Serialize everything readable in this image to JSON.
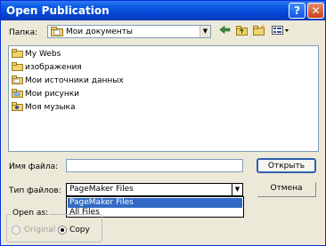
{
  "window": {
    "title": "Open Publication",
    "help": "?",
    "close": "✕"
  },
  "lookin": {
    "label": "Папка:",
    "value": "Мои документы"
  },
  "toolbar": {
    "back_icon": "back-arrow-icon",
    "up_icon": "folder-up-icon",
    "new_folder_icon": "new-folder-icon",
    "views_icon": "views-menu-icon"
  },
  "files": [
    {
      "name": "My Webs",
      "icon": "folder-icon"
    },
    {
      "name": "изображения",
      "icon": "folder-icon"
    },
    {
      "name": "Мои источники данных",
      "icon": "folder-icon"
    },
    {
      "name": "Мои рисунки",
      "icon": "folder-icon"
    },
    {
      "name": "Моя музыка",
      "icon": "folder-icon"
    }
  ],
  "filename": {
    "label": "Имя файла:",
    "value": ""
  },
  "filetype": {
    "label": "Тип файлов:",
    "value": "PageMaker Files",
    "options": [
      "PageMaker Files",
      "All Files"
    ]
  },
  "buttons": {
    "open": "Открыть",
    "cancel": "Отмена"
  },
  "openas": {
    "label": "Open as:",
    "original": "Original",
    "copy": "Copy"
  },
  "colors": {
    "title_bar": "#0a5ce6",
    "selection": "#316ac5",
    "folder": "#f2d36b"
  }
}
